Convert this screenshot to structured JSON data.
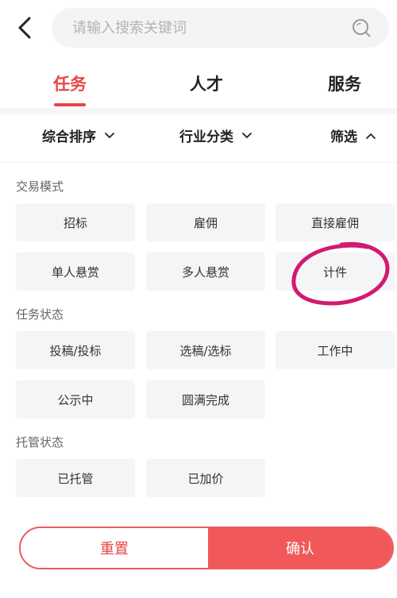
{
  "search": {
    "placeholder": "请输入搜索关键词"
  },
  "tabs": [
    {
      "label": "任务",
      "active": true
    },
    {
      "label": "人才",
      "active": false
    },
    {
      "label": "服务",
      "active": false
    }
  ],
  "filters": [
    {
      "label": "综合排序",
      "expanded": false
    },
    {
      "label": "行业分类",
      "expanded": false
    },
    {
      "label": "筛选",
      "expanded": true
    }
  ],
  "sections": {
    "trade_mode": {
      "title": "交易模式",
      "options": [
        "招标",
        "雇佣",
        "直接雇佣",
        "单人悬赏",
        "多人悬赏",
        "计件"
      ]
    },
    "task_status": {
      "title": "任务状态",
      "options": [
        "投稿/投标",
        "选稿/选标",
        "工作中",
        "公示中",
        "圆满完成"
      ]
    },
    "escrow_status": {
      "title": "托管状态",
      "options": [
        "已托管",
        "已加价"
      ]
    }
  },
  "actions": {
    "reset": "重置",
    "confirm": "确认"
  },
  "colors": {
    "accent": "#e84545",
    "annotation": "#d21a6f",
    "chip_bg": "#f4f5f7"
  }
}
